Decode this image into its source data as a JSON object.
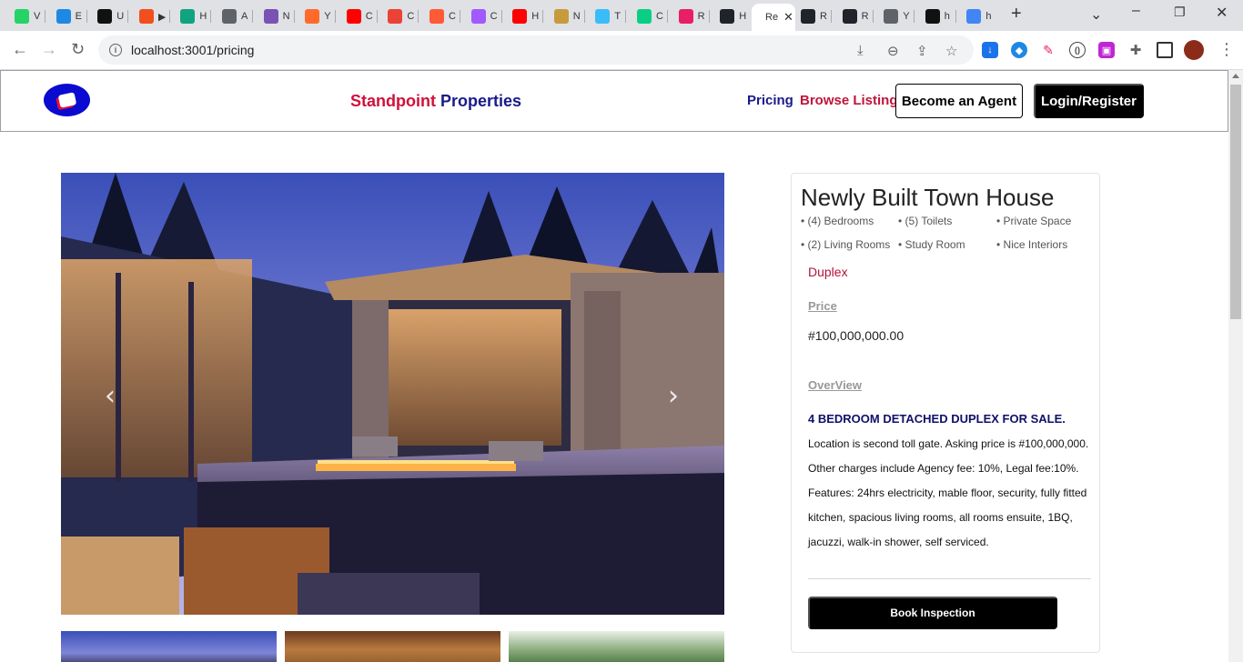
{
  "browser": {
    "tabs": [
      {
        "icon": "whatsapp-icon",
        "label": "V",
        "color": "#25d366"
      },
      {
        "icon": "edge-icon",
        "label": "E",
        "color": "#1e88e5"
      },
      {
        "icon": "medium-icon",
        "label": "U",
        "color": "#111111"
      },
      {
        "icon": "figma-icon",
        "label": "▶",
        "color": "#f24e1e"
      },
      {
        "icon": "chatgpt-icon",
        "label": "H",
        "color": "#10a37f"
      },
      {
        "icon": "globe-icon",
        "label": "A",
        "color": "#5f6368"
      },
      {
        "icon": "bootstrap-icon",
        "label": "N",
        "color": "#7952b3"
      },
      {
        "icon": "orange-app-icon",
        "label": "Y",
        "color": "#ff6a2a"
      },
      {
        "icon": "youtube-icon",
        "label": "C",
        "color": "#ff0000"
      },
      {
        "icon": "gmail-icon",
        "label": "C",
        "color": "#ea4335"
      },
      {
        "icon": "codepen-icon",
        "label": "C",
        "color": "#ff5a36"
      },
      {
        "icon": "figma-icon",
        "label": "C",
        "color": "#a259ff"
      },
      {
        "icon": "youtube-icon",
        "label": "H",
        "color": "#ff0000"
      },
      {
        "icon": "m-logo-icon",
        "label": "N",
        "color": "#c79b3b"
      },
      {
        "icon": "tailwind-icon",
        "label": "T",
        "color": "#38bdf8"
      },
      {
        "icon": "figma-icon",
        "label": "C",
        "color": "#0acf83"
      },
      {
        "icon": "react-icon",
        "label": "R",
        "color": "#e91e63"
      },
      {
        "icon": "react-icon",
        "label": "H",
        "color": "#20232a"
      }
    ],
    "active_tab": {
      "label": "Re",
      "close": "✕"
    },
    "tabs_after": [
      {
        "icon": "react-icon",
        "label": "R",
        "color": "#20232a"
      },
      {
        "icon": "react-icon",
        "label": "R",
        "color": "#20232a"
      },
      {
        "icon": "globe-icon",
        "label": "Y",
        "color": "#5f6368"
      },
      {
        "icon": "github-icon",
        "label": "h",
        "color": "#111111"
      },
      {
        "icon": "google-icon",
        "label": "h",
        "color": "#4285f4"
      }
    ],
    "new_tab": "+",
    "url": "localhost:3001/pricing"
  },
  "site": {
    "brand_part1": "Standpoint ",
    "brand_part2": "Properties",
    "nav_pricing": "Pricing",
    "nav_browse": "Browse Listing",
    "become_agent": "Become an Agent",
    "login_register": "Login/Register"
  },
  "carousel": {
    "prev": "‹",
    "next": "›"
  },
  "listing": {
    "title": "Newly Built Town House",
    "features": [
      "• (4) Bedrooms",
      "• (5) Toilets",
      "• Private Space",
      "• (2) Living Rooms",
      "• Study Room",
      "• Nice Interiors"
    ],
    "type": "Duplex",
    "price_label": "Price",
    "price": "#100,000,000.00",
    "overview_label": "OverView",
    "overview_heading": "4 BEDROOM DETACHED DUPLEX FOR SALE.",
    "overview_body": "Location is second toll gate. Asking price is #100,000,000. Other charges include Agency fee: 10%, Legal fee:10%. Features: 24hrs electricity, mable floor, security, fully fitted kitchen, spacious living rooms, all rooms ensuite, 1BQ, jacuzzi, walk-in shower, self serviced.",
    "book_button": "Book Inspection"
  }
}
